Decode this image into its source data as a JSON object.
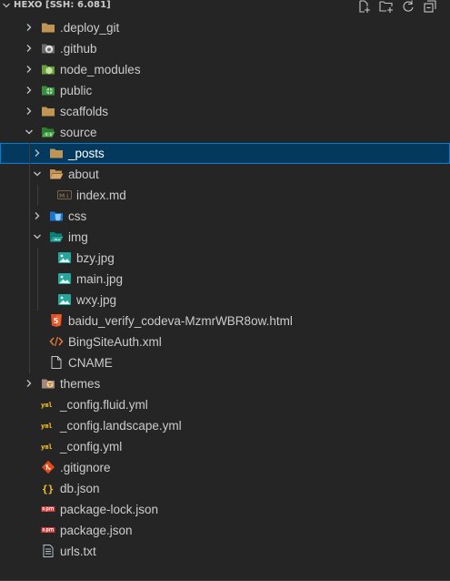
{
  "explorer": {
    "title": "HEXO [SSH: 6.081]",
    "actions": [
      {
        "name": "new-file-icon"
      },
      {
        "name": "new-folder-icon"
      },
      {
        "name": "refresh-icon"
      },
      {
        "name": "collapse-all-icon"
      }
    ]
  },
  "tree": [
    {
      "label": ".deploy_git",
      "type": "folder",
      "depth": 0,
      "expanded": false,
      "icon": "folder-icon",
      "color": "#c09553"
    },
    {
      "label": ".github",
      "type": "folder",
      "depth": 0,
      "expanded": false,
      "icon": "github-folder-icon",
      "color": "#cccccc"
    },
    {
      "label": "node_modules",
      "type": "folder",
      "depth": 0,
      "expanded": false,
      "icon": "node-folder-icon",
      "color": "#8bc34a"
    },
    {
      "label": "public",
      "type": "folder",
      "depth": 0,
      "expanded": false,
      "icon": "public-folder-icon",
      "color": "#4caf50"
    },
    {
      "label": "scaffolds",
      "type": "folder",
      "depth": 0,
      "expanded": false,
      "icon": "folder-icon",
      "color": "#c09553"
    },
    {
      "label": "source",
      "type": "folder",
      "depth": 0,
      "expanded": true,
      "icon": "source-folder-icon",
      "color": "#4caf50"
    },
    {
      "label": "_posts",
      "type": "folder",
      "depth": 1,
      "expanded": false,
      "icon": "folder-icon",
      "color": "#c09553",
      "selected": true
    },
    {
      "label": "about",
      "type": "folder",
      "depth": 1,
      "expanded": true,
      "icon": "folder-open-icon",
      "color": "#c09553"
    },
    {
      "label": "index.md",
      "type": "file",
      "depth": 2,
      "icon": "markdown-icon",
      "color": "#755838"
    },
    {
      "label": "css",
      "type": "folder",
      "depth": 1,
      "expanded": false,
      "icon": "css-folder-icon",
      "color": "#42a5f5"
    },
    {
      "label": "img",
      "type": "folder",
      "depth": 1,
      "expanded": true,
      "icon": "images-folder-icon",
      "color": "#26a69a"
    },
    {
      "label": "bzy.jpg",
      "type": "file",
      "depth": 2,
      "icon": "image-icon",
      "color": "#26a69a"
    },
    {
      "label": "main.jpg",
      "type": "file",
      "depth": 2,
      "icon": "image-icon",
      "color": "#26a69a"
    },
    {
      "label": "wxy.jpg",
      "type": "file",
      "depth": 2,
      "icon": "image-icon",
      "color": "#26a69a"
    },
    {
      "label": "baidu_verify_codeva-MzmrWBR8ow.html",
      "type": "file",
      "depth": 1,
      "icon": "html5-icon",
      "color": "#e44d26"
    },
    {
      "label": "BingSiteAuth.xml",
      "type": "file",
      "depth": 1,
      "icon": "xml-icon",
      "color": "#e37933"
    },
    {
      "label": "CNAME",
      "type": "file",
      "depth": 1,
      "icon": "file-icon",
      "color": "#cccccc"
    },
    {
      "label": "themes",
      "type": "folder",
      "depth": 0,
      "expanded": false,
      "icon": "themes-folder-icon",
      "color": "#c09553"
    },
    {
      "label": "_config.fluid.yml",
      "type": "file",
      "depth": 0,
      "icon": "yaml-icon",
      "color": "#e8d44d"
    },
    {
      "label": "_config.landscape.yml",
      "type": "file",
      "depth": 0,
      "icon": "yaml-icon",
      "color": "#e8d44d"
    },
    {
      "label": "_config.yml",
      "type": "file",
      "depth": 0,
      "icon": "yaml-icon",
      "color": "#e8d44d"
    },
    {
      "label": ".gitignore",
      "type": "file",
      "depth": 0,
      "icon": "git-icon",
      "color": "#e64a19"
    },
    {
      "label": "db.json",
      "type": "file",
      "depth": 0,
      "icon": "json-icon",
      "color": "#fbc02d"
    },
    {
      "label": "package-lock.json",
      "type": "file",
      "depth": 0,
      "icon": "npm-icon",
      "color": "#cb3837"
    },
    {
      "label": "package.json",
      "type": "file",
      "depth": 0,
      "icon": "npm-icon",
      "color": "#cb3837"
    },
    {
      "label": "urls.txt",
      "type": "file",
      "depth": 0,
      "icon": "text-file-icon",
      "color": "#90a4ae"
    }
  ]
}
